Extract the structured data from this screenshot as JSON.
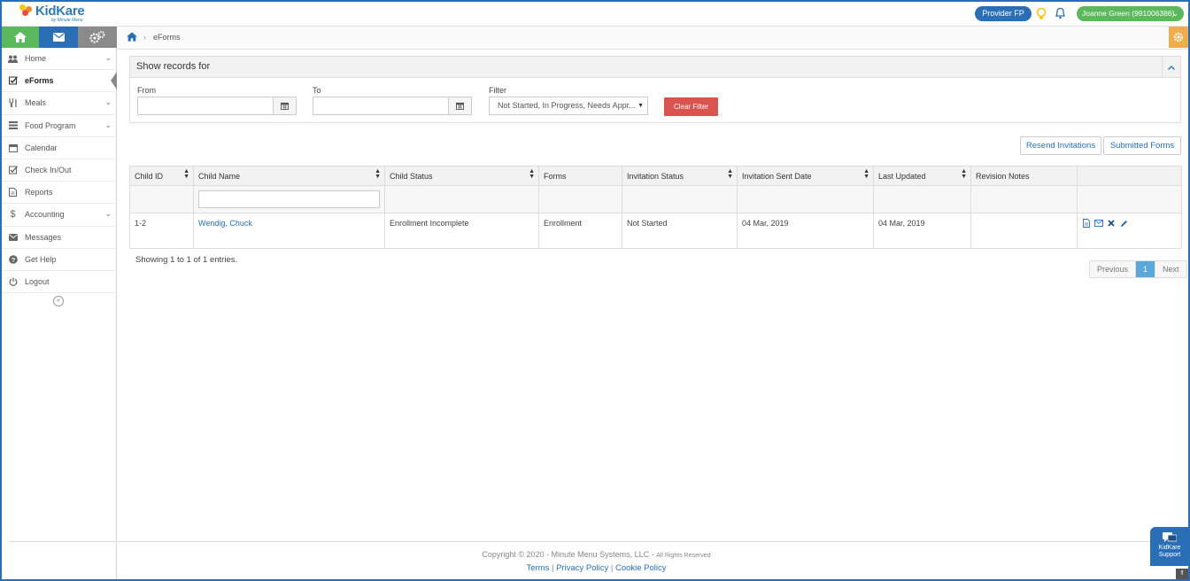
{
  "app": {
    "logo_text": "KidKare",
    "logo_sub": "by Minute Menu",
    "provider_button": "Provider FP",
    "user_button": "Joanne Green (991006386)"
  },
  "sidebar": {
    "items": [
      {
        "label": "Home",
        "icon": "users-icon",
        "expandable": true
      },
      {
        "label": "eForms",
        "icon": "checkbox-icon",
        "active": true
      },
      {
        "label": "Meals",
        "icon": "fork-knife-icon",
        "expandable": true
      },
      {
        "label": "Food Program",
        "icon": "list-icon",
        "expandable": true
      },
      {
        "label": "Calendar",
        "icon": "calendar-icon"
      },
      {
        "label": "Check In/Out",
        "icon": "check-icon"
      },
      {
        "label": "Reports",
        "icon": "document-icon"
      },
      {
        "label": "Accounting",
        "icon": "dollar-icon",
        "expandable": true
      },
      {
        "label": "Messages",
        "icon": "envelope-icon"
      },
      {
        "label": "Get Help",
        "icon": "question-icon"
      },
      {
        "label": "Logout",
        "icon": "power-icon"
      }
    ]
  },
  "breadcrumb": {
    "current": "eForms",
    "separator": "›"
  },
  "filters": {
    "panel_title": "Show records for",
    "from_label": "From",
    "to_label": "To",
    "filter_label": "Filter",
    "filter_value": "Not Started, In Progress, Needs Appr...",
    "from_value": "",
    "to_value": "",
    "clear_button": "Clear Filter"
  },
  "actions": {
    "resend": "Resend Invitations",
    "submitted": "Submitted Forms"
  },
  "table": {
    "columns": [
      "Child ID",
      "Child Name",
      "Child Status",
      "Forms",
      "Invitation Status",
      "Invitation Sent Date",
      "Last Updated",
      "Revision Notes",
      ""
    ],
    "sortable": [
      true,
      true,
      true,
      false,
      true,
      true,
      true,
      false,
      false
    ],
    "rows": [
      {
        "child_id": "1-2",
        "child_name": "Wendig, Chuck",
        "child_status": "Enrollment Incomplete",
        "forms": "Enrollment",
        "invitation_status": "Not Started",
        "invitation_sent_date": "04 Mar, 2019",
        "last_updated": "04 Mar, 2019",
        "revision_notes": ""
      }
    ],
    "showing_text": "Showing 1 to 1 of 1 entries."
  },
  "pager": {
    "previous": "Previous",
    "current": "1",
    "next": "Next"
  },
  "footer": {
    "copyright": "Copyright © 2020 - Minute Menu Systems, LLC - ",
    "rights": "All Rights Reserved",
    "terms": "Terms",
    "privacy": "Privacy Policy",
    "cookie": "Cookie Policy",
    "sep": "|"
  },
  "support": {
    "line1": "KidKare",
    "line2": "Support"
  },
  "colors": {
    "brand_blue": "#2a6fb5",
    "green": "#5cb85c",
    "gray_tab": "#8a8a8a",
    "danger": "#d9534f",
    "orange": "#f0ad4e"
  }
}
